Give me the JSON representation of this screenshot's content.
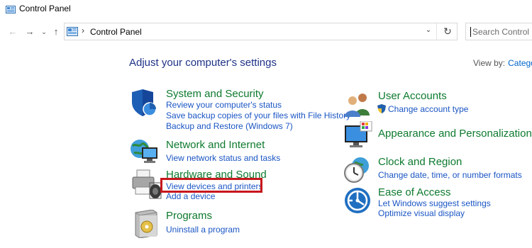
{
  "window": {
    "title": "Control Panel"
  },
  "navigation": {
    "back_glyph": "←",
    "forward_glyph": "→",
    "recent_glyph": "⌄",
    "up_glyph": "↑",
    "breadcrumb_separator": "›",
    "breadcrumb": "Control Panel",
    "address_dropdown_glyph": "⌄",
    "refresh_glyph": "↻",
    "search_placeholder": "Search Control Panel"
  },
  "main": {
    "heading": "Adjust your computer's settings",
    "view_by_label": "View by:",
    "view_by_value": "Category"
  },
  "categories_left": [
    {
      "title": "System and Security",
      "icon": "system-security-shield-icon",
      "tasks": [
        "Review your computer's status",
        "Save backup copies of your files with File History",
        "Backup and Restore (Windows 7)"
      ]
    },
    {
      "title": "Network and Internet",
      "icon": "network-globe-icon",
      "tasks": [
        "View network status and tasks"
      ]
    },
    {
      "title": "Hardware and Sound",
      "icon": "printer-speaker-icon",
      "tasks": [
        "View devices and printers",
        "Add a device"
      ]
    },
    {
      "title": "Programs",
      "icon": "programs-box-icon",
      "tasks": [
        "Uninstall a program"
      ]
    }
  ],
  "categories_right": [
    {
      "title": "User Accounts",
      "icon": "users-icon",
      "tasks": [
        "Change account type"
      ]
    },
    {
      "title": "Appearance and Personalization",
      "icon": "monitor-palette-icon",
      "tasks": []
    },
    {
      "title": "Clock and Region",
      "icon": "clock-globe-icon",
      "tasks": [
        "Change date, time, or number formats"
      ]
    },
    {
      "title": "Ease of Access",
      "icon": "ease-of-access-icon",
      "tasks": [
        "Let Windows suggest settings",
        "Optimize visual display"
      ]
    }
  ],
  "colors": {
    "category_title": "#0d7a2e",
    "task_link": "#1a55c4",
    "heading": "#1e3287",
    "highlight": "#c7161c"
  }
}
